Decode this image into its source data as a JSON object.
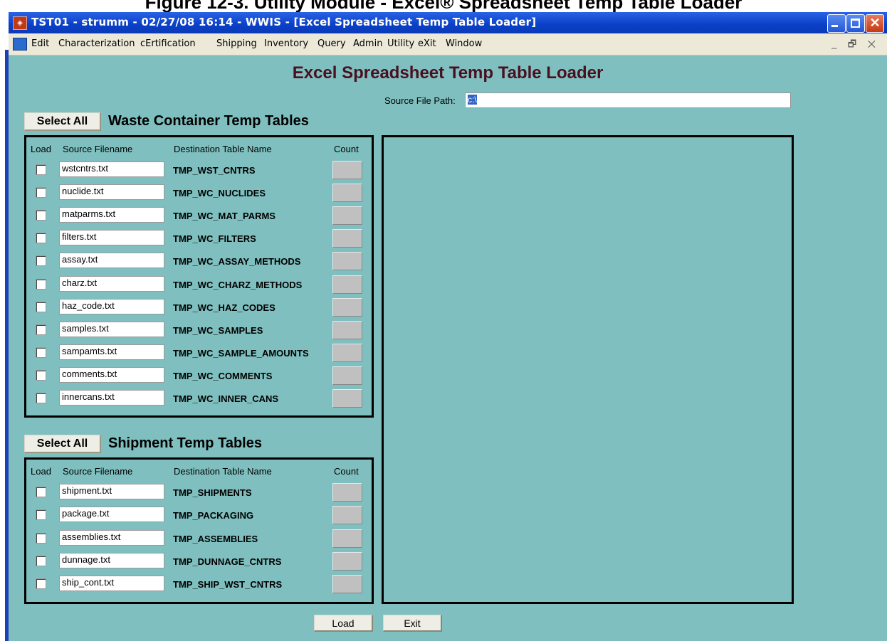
{
  "caption": "Figure 12-3. Utility Module - Excel® Spreadsheet Temp Table Loader",
  "window": {
    "title": "TST01 - strumm - 02/27/08 16:14 - WWIS - [Excel Spreadsheet Temp Table Loader]"
  },
  "menu": [
    "Edit",
    "Characterization",
    "cErtification",
    "Shipping",
    "Inventory",
    "Query",
    "Admin",
    "Utility",
    "eXit",
    "Window"
  ],
  "form": {
    "title": "Excel Spreadsheet Temp Table Loader",
    "source_label": "Source File Path:",
    "source_value": "c:\\",
    "headers": {
      "load": "Load",
      "source": "Source Filename",
      "dest": "Destination Table Name",
      "count": "Count"
    },
    "waste": {
      "select_all": "Select All",
      "title": "Waste Container Temp Tables",
      "rows": [
        {
          "file": "wstcntrs.txt",
          "table": "TMP_WST_CNTRS"
        },
        {
          "file": "nuclide.txt",
          "table": "TMP_WC_NUCLIDES"
        },
        {
          "file": "matparms.txt",
          "table": "TMP_WC_MAT_PARMS"
        },
        {
          "file": "filters.txt",
          "table": "TMP_WC_FILTERS"
        },
        {
          "file": "assay.txt",
          "table": "TMP_WC_ASSAY_METHODS"
        },
        {
          "file": "charz.txt",
          "table": "TMP_WC_CHARZ_METHODS"
        },
        {
          "file": "haz_code.txt",
          "table": "TMP_WC_HAZ_CODES"
        },
        {
          "file": "samples.txt",
          "table": "TMP_WC_SAMPLES"
        },
        {
          "file": "sampamts.txt",
          "table": "TMP_WC_SAMPLE_AMOUNTS"
        },
        {
          "file": "comments.txt",
          "table": "TMP_WC_COMMENTS"
        },
        {
          "file": "innercans.txt",
          "table": "TMP_WC_INNER_CANS"
        }
      ]
    },
    "shipment": {
      "select_all": "Select All",
      "title": "Shipment Temp Tables",
      "rows": [
        {
          "file": "shipment.txt",
          "table": "TMP_SHIPMENTS"
        },
        {
          "file": "package.txt",
          "table": "TMP_PACKAGING"
        },
        {
          "file": "assemblies.txt",
          "table": "TMP_ASSEMBLIES"
        },
        {
          "file": "dunnage.txt",
          "table": "TMP_DUNNAGE_CNTRS"
        },
        {
          "file": "ship_cont.txt",
          "table": "TMP_SHIP_WST_CNTRS"
        }
      ]
    },
    "load_button": "Load",
    "exit_button": "Exit"
  }
}
